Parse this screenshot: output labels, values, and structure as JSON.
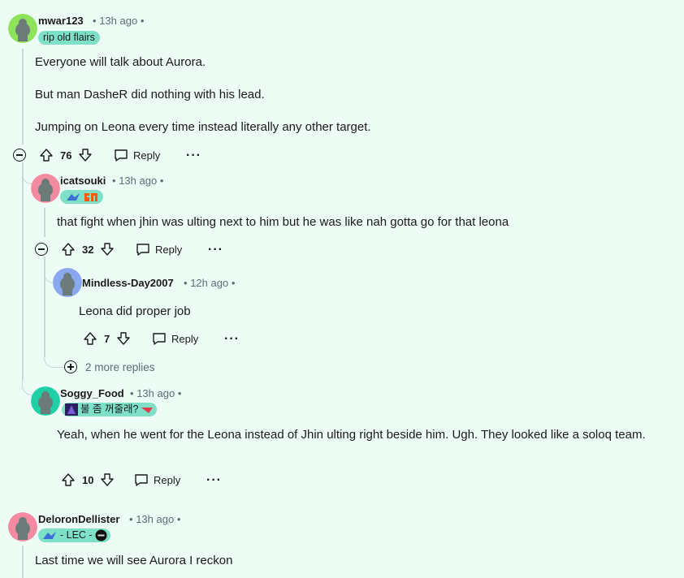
{
  "comments": [
    {
      "username": "mwar123",
      "time": "13h ago",
      "flair": "rip old flairs",
      "body": [
        "Everyone will talk about Aurora.",
        "But man DasheR did nothing with his lead.",
        "Jumping on Leona every time instead literally any other target."
      ],
      "votes": "76",
      "reply_label": "Reply",
      "avatar_color": "#8fe35a"
    },
    {
      "username": "icatsouki",
      "time": "13h ago",
      "body": [
        "that fight when jhin was ulting next to him but he was like nah gotta go for that leona"
      ],
      "votes": "32",
      "reply_label": "Reply",
      "avatar_color": "#f38aa0"
    },
    {
      "username": "Mindless-Day2007",
      "time": "12h ago",
      "body": [
        "Leona did proper job"
      ],
      "votes": "7",
      "reply_label": "Reply",
      "avatar_color": "#8aa8ef"
    },
    {
      "username": "Soggy_Food",
      "time": "13h ago",
      "flair": "불 좀 꺼줄래?",
      "body": [
        "Yeah, when he went for the Leona instead of Jhin ulting right beside him. Ugh. They looked like a soloq team."
      ],
      "votes": "10",
      "reply_label": "Reply",
      "avatar_color": "#1fd0a6"
    },
    {
      "username": "DeloronDellister",
      "time": "13h ago",
      "flair": "- LEC -",
      "body": [
        "Last time we will see Aurora I reckon"
      ],
      "avatar_color": "#f38aa0"
    }
  ],
  "more_replies": "2 more replies",
  "separator": "•",
  "icons": [
    "upvote-icon",
    "downvote-icon",
    "comment-icon",
    "more-icon",
    "collapse-icon",
    "expand-icon"
  ]
}
